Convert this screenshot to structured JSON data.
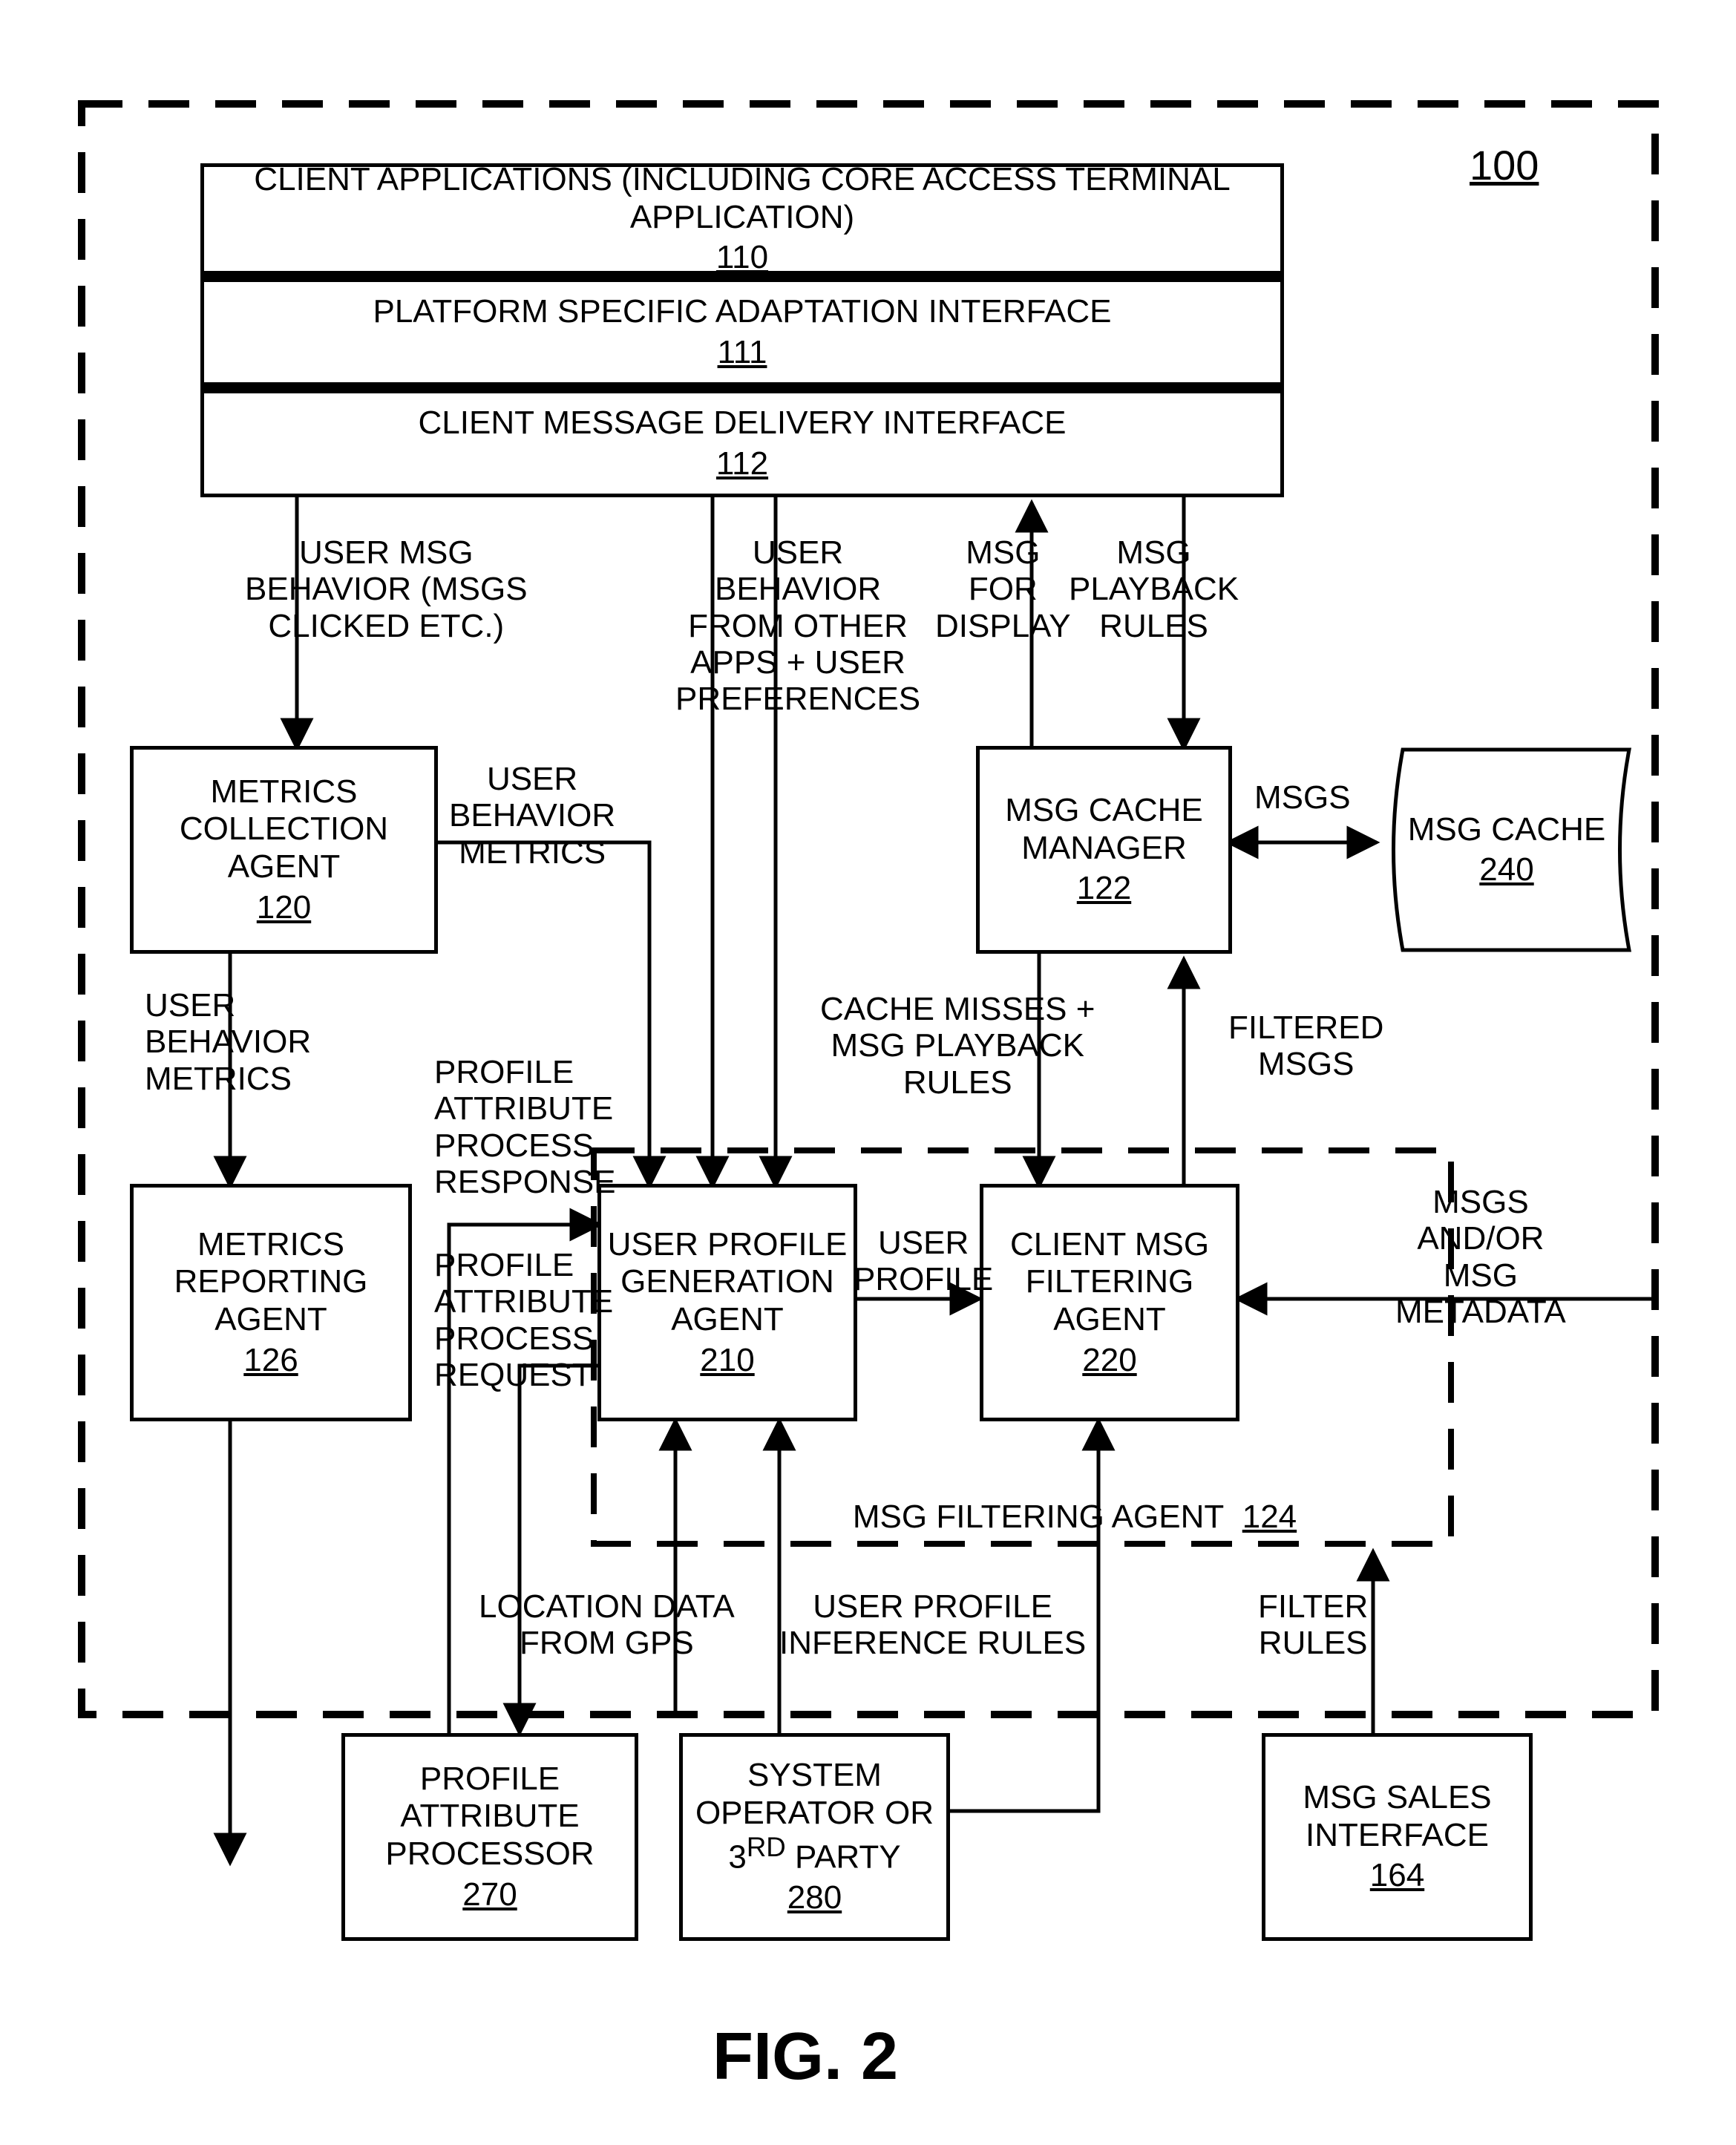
{
  "ref100": "100",
  "box110": {
    "title": "CLIENT APPLICATIONS (INCLUDING CORE ACCESS TERMINAL APPLICATION)",
    "ref": "110"
  },
  "box111": {
    "title": "PLATFORM SPECIFIC ADAPTATION INTERFACE",
    "ref": "111"
  },
  "box112": {
    "title": "CLIENT MESSAGE DELIVERY INTERFACE",
    "ref": "112"
  },
  "box120": {
    "title": "METRICS COLLECTION AGENT",
    "ref": "120"
  },
  "box122": {
    "title": "MSG CACHE MANAGER",
    "ref": "122"
  },
  "box240": {
    "title": "MSG CACHE",
    "ref": "240"
  },
  "box126": {
    "title": "METRICS REPORTING AGENT",
    "ref": "126"
  },
  "box210": {
    "title": "USER PROFILE GENERATION AGENT",
    "ref": "210"
  },
  "box220": {
    "title": "CLIENT MSG FILTERING AGENT",
    "ref": "220"
  },
  "box124": {
    "title": "MSG FILTERING AGENT",
    "ref": "124"
  },
  "box270": {
    "title": "PROFILE ATTRIBUTE PROCESSOR",
    "ref": "270"
  },
  "box280": {
    "title": "SYSTEM OPERATOR OR 3",
    "sup": "RD",
    "suffix": " PARTY",
    "ref": "280"
  },
  "box164": {
    "title": "MSG SALES INTERFACE",
    "ref": "164"
  },
  "lblUserMsgBehavior": "USER MSG\nBEHAVIOR (MSGS\nCLICKED ETC.)",
  "lblUserBehMetrics1": "USER\nBEHAVIOR\nMETRICS",
  "lblUserBehMetrics2": "USER\nBEHAVIOR\nMETRICS",
  "lblUserBehaviorPrefs": "USER\nBEHAVIOR\nFROM OTHER\nAPPS + USER\nPREFERENCES",
  "lblMsgForDisplay": "MSG\nFOR\nDISPLAY",
  "lblMsgPlaybackRules": "MSG\nPLAYBACK\nRULES",
  "lblMsgs": "MSGS",
  "lblProfAttrProcResp": "PROFILE\nATTRIBUTE\nPROCESS\nRESPONSE",
  "lblProfAttrProcReq": "PROFILE\nATTRIBUTE\nPROCESS\nREQUEST",
  "lblCacheMisses": "CACHE MISSES +\nMSG PLAYBACK\nRULES",
  "lblFilteredMsgs": "FILTERED\nMSGS",
  "lblUserProfile": "USER\nPROFILE",
  "lblMsgsMetadata": "MSGS\nAND/OR\nMSG\nMETADATA",
  "lblLocationData": "LOCATION DATA\nFROM GPS",
  "lblUserProfileInfRules": "USER PROFILE\nINFERENCE RULES",
  "lblFilterRules": "FILTER\nRULES",
  "figCaption": "FIG. 2"
}
